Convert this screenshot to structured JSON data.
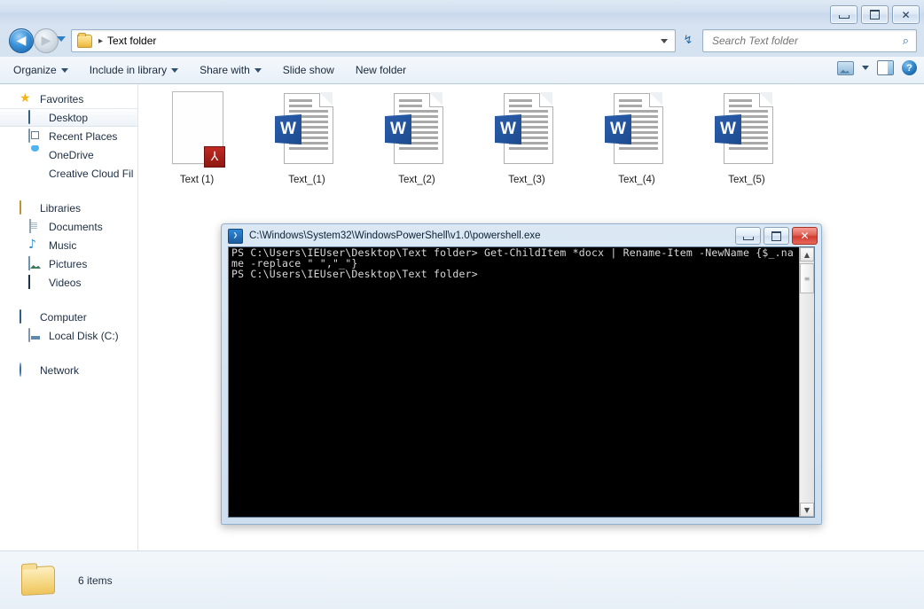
{
  "window": {
    "title": "",
    "controls": {
      "minimize": "—",
      "maximize": "□",
      "close": "✕"
    }
  },
  "nav": {
    "back_label": "◀",
    "forward_label": "▶",
    "history_label": "▾",
    "address_text": "Text folder",
    "address_separator": "▸",
    "refresh_label": "↯"
  },
  "search": {
    "placeholder": "Search Text folder",
    "icon": "search-icon",
    "glyph": "⌕"
  },
  "toolbar": {
    "items": [
      {
        "label": "Organize",
        "caret": true
      },
      {
        "label": "Include in library",
        "caret": true
      },
      {
        "label": "Share with",
        "caret": true
      },
      {
        "label": "Slide show",
        "caret": false
      },
      {
        "label": "New folder",
        "caret": false
      }
    ],
    "right_icons": [
      "view-icon",
      "view-dropdown-caret",
      "preview-pane-icon",
      "help-icon"
    ],
    "help_glyph": "?"
  },
  "sidebar": {
    "groups": [
      {
        "header": {
          "label": "Favorites",
          "icon": "star-icon"
        },
        "items": [
          {
            "label": "Desktop",
            "icon": "monitor-icon",
            "selected": true
          },
          {
            "label": "Recent Places",
            "icon": "recent-places-icon",
            "selected": false
          },
          {
            "label": "OneDrive",
            "icon": "cloud-icon",
            "selected": false
          },
          {
            "label": "Creative Cloud Fil",
            "icon": "creative-cloud-icon",
            "selected": false
          }
        ]
      },
      {
        "header": {
          "label": "Libraries",
          "icon": "libraries-icon"
        },
        "items": [
          {
            "label": "Documents",
            "icon": "document-icon",
            "selected": false
          },
          {
            "label": "Music",
            "icon": "music-note-icon",
            "selected": false
          },
          {
            "label": "Pictures",
            "icon": "picture-icon",
            "selected": false
          },
          {
            "label": "Videos",
            "icon": "video-icon",
            "selected": false
          }
        ]
      },
      {
        "header": {
          "label": "Computer",
          "icon": "computer-icon"
        },
        "items": [
          {
            "label": "Local Disk (C:)",
            "icon": "disk-icon",
            "selected": false
          }
        ]
      },
      {
        "header": {
          "label": "Network",
          "icon": "network-icon"
        },
        "items": []
      }
    ]
  },
  "files": [
    {
      "name": "Text (1)",
      "type": "pdf",
      "badge": "pdf-icon"
    },
    {
      "name": "Text_(1)",
      "type": "word",
      "badge": "W"
    },
    {
      "name": "Text_(2)",
      "type": "word",
      "badge": "W"
    },
    {
      "name": "Text_(3)",
      "type": "word",
      "badge": "W"
    },
    {
      "name": "Text_(4)",
      "type": "word",
      "badge": "W"
    },
    {
      "name": "Text_(5)",
      "type": "word",
      "badge": "W"
    }
  ],
  "status": {
    "item_count": "6 items",
    "folder_icon": "folder-icon"
  },
  "powershell": {
    "title": "C:\\Windows\\System32\\WindowsPowerShell\\v1.0\\powershell.exe",
    "icon": "powershell-icon",
    "icon_glyph": "❯",
    "controls": {
      "minimize": "—",
      "maximize": "□",
      "close": "✕"
    },
    "console_text": "PS C:\\Users\\IEUser\\Desktop\\Text folder> Get-ChildItem *docx | Rename-Item -NewName {$_.name -replace \" \",\"_\"}\nPS C:\\Users\\IEUser\\Desktop\\Text folder>",
    "scrollbar": {
      "up": "▲",
      "down": "▼",
      "thumb": "≡"
    }
  },
  "colors": {
    "accent_blue": "#2a5caa",
    "pdf_red": "#c02a23",
    "close_red": "#cf3c2e",
    "folder_yellow": "#f6d987"
  }
}
